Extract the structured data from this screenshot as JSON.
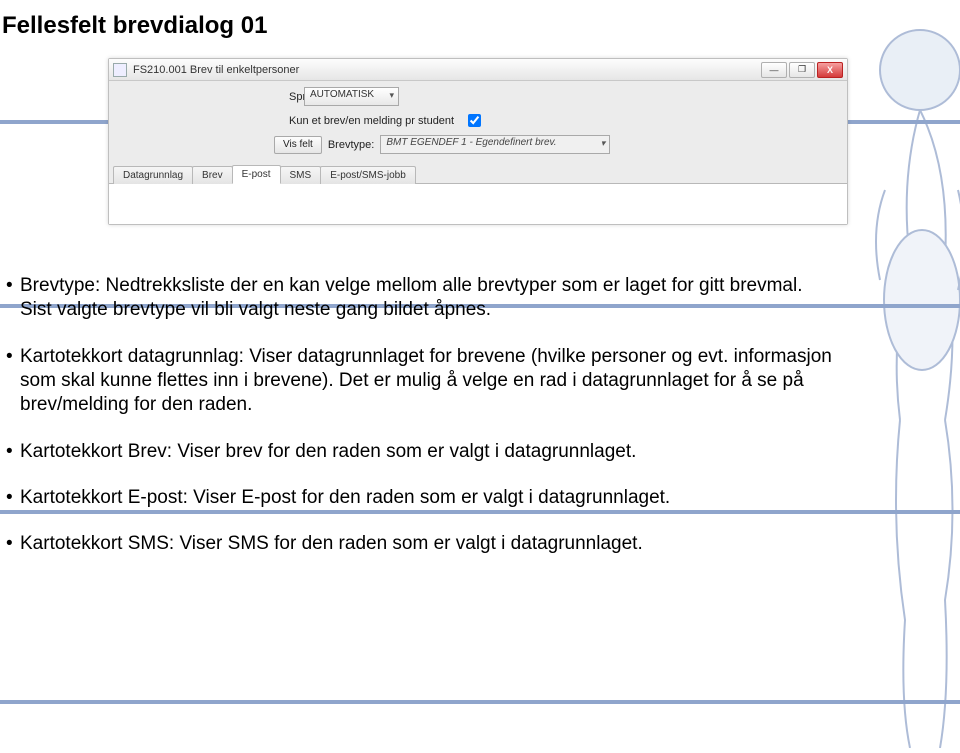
{
  "page": {
    "title": "Fellesfelt brevdialog 01"
  },
  "window": {
    "title": "FS210.001 Brev til enkeltpersoner",
    "controls": {
      "minimize": "—",
      "restore": "❐",
      "close": "X"
    }
  },
  "form": {
    "language_label": "Språk:",
    "language_value": "AUTOMATISK",
    "one_letter_label": "Kun et brev/en melding pr student",
    "one_letter_checked": true,
    "show_field_button": "Vis felt",
    "brevtype_label": "Brevtype:",
    "brevtype_value": "BMT EGENDEF 1 - Egendefinert brev."
  },
  "tabs": [
    {
      "label": "Datagrunnlag",
      "active": false
    },
    {
      "label": "Brev",
      "active": false
    },
    {
      "label": "E-post",
      "active": true
    },
    {
      "label": "SMS",
      "active": false
    },
    {
      "label": "E-post/SMS-jobb",
      "active": false
    }
  ],
  "bullets": [
    "Brevtype: Nedtrekksliste der en kan velge mellom alle brevtyper som er laget for gitt brevmal. Sist valgte brevtype vil bli valgt neste gang bildet åpnes.",
    "Kartotekkort datagrunnlag: Viser datagrunnlaget for brevene (hvilke personer og evt. informasjon som skal kunne flettes inn i brevene). Det er mulig å velge en rad i datagrunnlaget for å se på brev/melding for den raden.",
    "Kartotekkort Brev: Viser brev for den raden som er valgt i datagrunnlaget.",
    "Kartotekkort E-post: Viser E-post for den raden som er valgt i datagrunnlaget.",
    "Kartotekkort SMS: Viser SMS for den raden som er valgt i datagrunnlaget."
  ]
}
